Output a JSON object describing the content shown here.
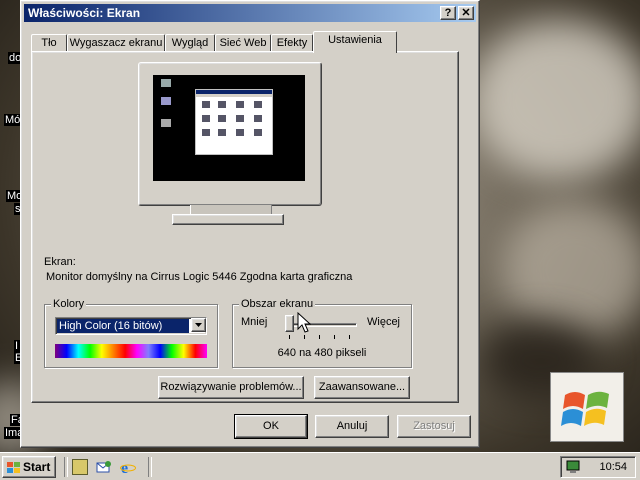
{
  "window": {
    "title": "Właściwości: Ekran",
    "help_button": "?",
    "close_button": "✕"
  },
  "tabs": [
    {
      "label": "Tło"
    },
    {
      "label": "Wygaszacz ekranu"
    },
    {
      "label": "Wygląd"
    },
    {
      "label": "Sieć Web"
    },
    {
      "label": "Efekty"
    },
    {
      "label": "Ustawienia"
    }
  ],
  "settings": {
    "display_label": "Ekran:",
    "display_value": "Monitor domyślny na Cirrus Logic 5446 Zgodna karta graficzna",
    "colors": {
      "group_label": "Kolory",
      "selected": "High Color (16 bitów)"
    },
    "screen_area": {
      "group_label": "Obszar ekranu",
      "less_label": "Mniej",
      "more_label": "Więcej",
      "resolution_text": "640 na 480 pikseli",
      "slider_level": 0.0
    },
    "troubleshoot_button": "Rozwiązywanie problemów...",
    "advanced_button": "Zaawansowane..."
  },
  "dialog_buttons": {
    "ok": "OK",
    "cancel": "Anuluj",
    "apply": "Zastosuj"
  },
  "desktop": {
    "icon_texts": [
      "do",
      "Mój",
      "Moj",
      "s",
      "I",
      "E",
      "Fa",
      "Ima"
    ]
  },
  "taskbar": {
    "start_label": "Start",
    "clock": "10:54"
  },
  "colors": {
    "title_start": "#0a246a",
    "title_end": "#a6caf0",
    "face": "#d4d0c8",
    "select_highlight": "#0a246a"
  }
}
